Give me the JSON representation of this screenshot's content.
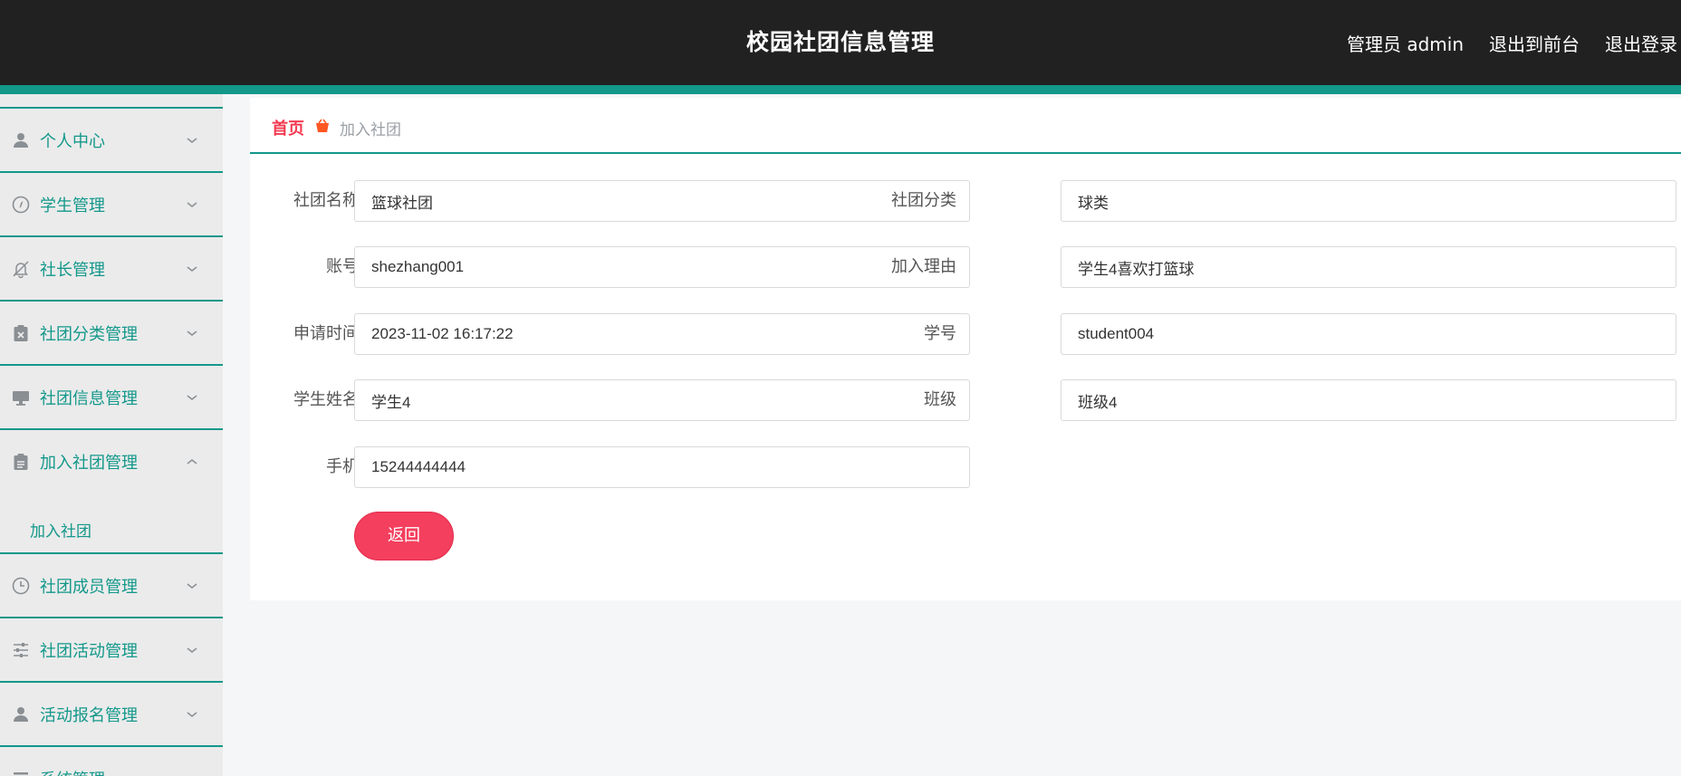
{
  "header": {
    "title": "校园社团信息管理",
    "admin_label": "管理员 admin",
    "frontend_link": "退出到前台",
    "logout_link": "退出登录"
  },
  "sidebar": {
    "items": [
      {
        "label": "个人中心",
        "icon": "user-icon",
        "expanded": false
      },
      {
        "label": "学生管理",
        "icon": "compass-icon",
        "expanded": false
      },
      {
        "label": "社长管理",
        "icon": "bell-off-icon",
        "expanded": false
      },
      {
        "label": "社团分类管理",
        "icon": "clipboard-x-icon",
        "expanded": false
      },
      {
        "label": "社团信息管理",
        "icon": "monitor-icon",
        "expanded": false
      },
      {
        "label": "加入社团管理",
        "icon": "clipboard-icon",
        "expanded": true,
        "children": [
          {
            "label": "加入社团"
          }
        ]
      },
      {
        "label": "社团成员管理",
        "icon": "clock-icon",
        "expanded": false
      },
      {
        "label": "社团活动管理",
        "icon": "sliders-icon",
        "expanded": false
      },
      {
        "label": "活动报名管理",
        "icon": "user-icon",
        "expanded": false
      },
      {
        "label": "系统管理",
        "icon": "menu-icon",
        "expanded": false
      }
    ]
  },
  "breadcrumb": {
    "home": "首页",
    "current": "加入社团",
    "separator_icon": "basket-icon"
  },
  "form": {
    "fields": [
      {
        "label": "社团名称",
        "value": "篮球社团"
      },
      {
        "label": "社团分类",
        "value": "球类"
      },
      {
        "label": "账号",
        "value": "shezhang001"
      },
      {
        "label": "加入理由",
        "value": "学生4喜欢打篮球"
      },
      {
        "label": "申请时间",
        "value": "2023-11-02 16:17:22"
      },
      {
        "label": "学号",
        "value": "student004"
      },
      {
        "label": "学生姓名",
        "value": "学生4"
      },
      {
        "label": "班级",
        "value": "班级4"
      },
      {
        "label": "手机",
        "value": "15244444444"
      }
    ],
    "back_button": "返回"
  },
  "colors": {
    "header_bg": "#212121",
    "accent_teal": "#13988a",
    "primary_red": "#f43f5e",
    "sidebar_bg": "#ebebeb"
  }
}
